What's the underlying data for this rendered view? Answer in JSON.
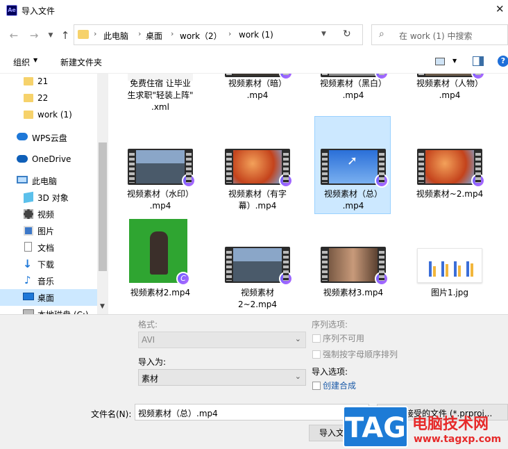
{
  "window": {
    "title": "导入文件",
    "app_icon_text": "Ae",
    "close_label": "✕"
  },
  "address": {
    "crumbs": [
      "此电脑",
      "桌面",
      "work（2）",
      "work (1)"
    ],
    "search_placeholder": "在 work (1) 中搜索"
  },
  "toolbar": {
    "organize_label": "组织",
    "new_folder_label": "新建文件夹",
    "help_label": "?"
  },
  "nav": {
    "items": [
      {
        "label": "21",
        "icon": "folder-icon"
      },
      {
        "label": "22",
        "icon": "folder-icon"
      },
      {
        "label": "work (1)",
        "icon": "folder-icon"
      },
      {
        "label": "WPS云盘",
        "icon": "cloud-icon"
      },
      {
        "label": "OneDrive",
        "icon": "cloud-icon"
      },
      {
        "label": "此电脑",
        "icon": "computer-icon"
      },
      {
        "label": "3D 对象",
        "icon": "3d-objects-icon"
      },
      {
        "label": "视频",
        "icon": "video-icon"
      },
      {
        "label": "图片",
        "icon": "pictures-icon"
      },
      {
        "label": "文档",
        "icon": "documents-icon"
      },
      {
        "label": "下载",
        "icon": "download-icon"
      },
      {
        "label": "音乐",
        "icon": "music-icon"
      },
      {
        "label": "桌面",
        "icon": "desktop-icon"
      },
      {
        "label": "本地磁盘 (C:)",
        "icon": "drive-icon"
      }
    ]
  },
  "files": {
    "row0": [
      "免费住宿  让毕业生求职\"轻装上阵\".xml",
      "视频素材（暗）.mp4",
      "视频素材（黑白）.mp4",
      "视频素材（人物）.mp4"
    ],
    "row1": [
      "视频素材（水印）.mp4",
      "视频素材（有字幕）.mp4",
      "视频素材（总）.mp4",
      "视频素材~2.mp4"
    ],
    "row2": [
      "视频素材2.mp4",
      "视频素材2~2.mp4",
      "视频素材3.mp4",
      "图片1.jpg"
    ],
    "row0_lines": [
      [
        "免费住宿  让毕业",
        "生求职\"轻装上阵\"",
        ".xml"
      ],
      [
        "视频素材（暗）",
        ".mp4"
      ],
      [
        "视频素材（黑白）",
        ".mp4"
      ],
      [
        "视频素材（人物）",
        ".mp4"
      ]
    ],
    "row1_lines": [
      [
        "视频素材（水印）",
        ".mp4"
      ],
      [
        "视频素材（有字",
        "幕）.mp4"
      ],
      [
        "视频素材（总）",
        ".mp4"
      ],
      [
        "视频素材~2.mp4"
      ]
    ],
    "row2_lines": [
      [
        "视频素材2.mp4"
      ],
      [
        "视频素材",
        "2~2.mp4"
      ],
      [
        "视频素材3.mp4"
      ],
      [
        "图片1.jpg"
      ]
    ],
    "selected": "视频素材（总）.mp4"
  },
  "options": {
    "format_label": "格式:",
    "format_value": "AVI",
    "import_as_label": "导入为:",
    "import_as_value": "素材",
    "sequence_options_label": "序列选项:",
    "sequence_unavailable": "序列不可用",
    "force_alpha_order": "强制按字母顺序排列",
    "import_options_label": "导入选项:",
    "create_comp": "创建合成"
  },
  "footer": {
    "filename_label": "文件名(N):",
    "filename_value": "视频素材（总）.mp4",
    "filetype_value": "所有可接受的文件 (*.prproj...",
    "import_button": "导入文件夹"
  },
  "watermark": {
    "tag": "TAG",
    "brand": "电脑技术网",
    "url": "www.tagxp.com"
  }
}
